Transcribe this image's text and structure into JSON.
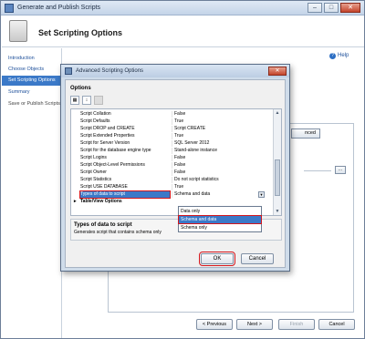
{
  "window": {
    "title": "Generate and Publish Scripts"
  },
  "header": {
    "title": "Set Scripting Options"
  },
  "nav": {
    "items": [
      {
        "label": "Introduction"
      },
      {
        "label": "Choose Objects"
      },
      {
        "label": "Set Scripting Options"
      },
      {
        "label": "Summary"
      },
      {
        "label": "Save or Publish Scripts"
      }
    ]
  },
  "help": {
    "label": "Help"
  },
  "background": {
    "advanced_label": "nced",
    "small_btn": "..."
  },
  "footer": {
    "previous": "< Previous",
    "next": "Next >",
    "finish": "Finish",
    "cancel": "Cancel"
  },
  "dialog": {
    "title": "Advanced Scripting Options",
    "section": "Options",
    "rows": [
      {
        "name": "Script Collation",
        "value": "False"
      },
      {
        "name": "Script Defaults",
        "value": "True"
      },
      {
        "name": "Script DROP and CREATE",
        "value": "Script CREATE"
      },
      {
        "name": "Script Extended Properties",
        "value": "True"
      },
      {
        "name": "Script for Server Version",
        "value": "SQL Server 2012"
      },
      {
        "name": "Script for the database engine type",
        "value": "Stand-alone instance"
      },
      {
        "name": "Script Logins",
        "value": "False"
      },
      {
        "name": "Script Object-Level Permissions",
        "value": "False"
      },
      {
        "name": "Script Owner",
        "value": "False"
      },
      {
        "name": "Script Statistics",
        "value": "Do not script statistics"
      },
      {
        "name": "Script USE DATABASE",
        "value": "True"
      },
      {
        "name": "Types of data to script",
        "value": "Schema and data"
      }
    ],
    "category": "Table/View Options",
    "dropdown_options": [
      "Data only",
      "Schema and data",
      "Schema only"
    ],
    "description_title": "Types of data to script",
    "description_text": "Generates script that contains schema only",
    "ok": "OK",
    "cancel": "Cancel"
  }
}
